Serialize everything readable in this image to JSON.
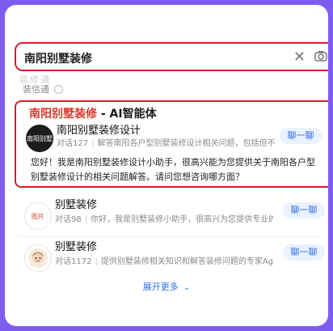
{
  "search": {
    "query": "南阳别墅装修",
    "clear_icon": "close-icon",
    "camera_icon": "camera-icon"
  },
  "hint": "装修通",
  "source": {
    "label": "装信通"
  },
  "featured": {
    "title_highlight": "南阳别墅装修",
    "title_rest": " - AI智能体",
    "agent_name": "南阳别墅装修设计",
    "dialogs": "对话127",
    "description": "解答南阳各户型别墅装修设计相关问题，包括但不限于...",
    "chat_label": "聊一聊",
    "greeting": "您好！我是南阳别墅装修设计小助手，很高兴能为您提供关于南阳各户型别墅装修设计的相关问题解答。请问您想咨询哪方面？",
    "avatar_text": "南阳别墅"
  },
  "results": [
    {
      "agent_name": "别墅装修",
      "dialogs": "对话98",
      "description": "你好，我是别墅装修小助手，很高兴为您提供专业的装...",
      "chat_label": "聊一聊",
      "avatar_text": "图片"
    },
    {
      "agent_name": "别墅装修",
      "dialogs": "对话1172",
      "description": "提供别墅装修相关知识和解答装修问题的专家Agent。",
      "chat_label": "聊一聊",
      "avatar_text": ""
    }
  ],
  "more": {
    "label": "展开更多"
  },
  "colors": {
    "background": "#7d5cf0",
    "highlight_border": "#d0202a",
    "title_red": "#d8392c",
    "chat_blue": "#2f6fe4",
    "chat_bg": "#eaf1ff"
  }
}
